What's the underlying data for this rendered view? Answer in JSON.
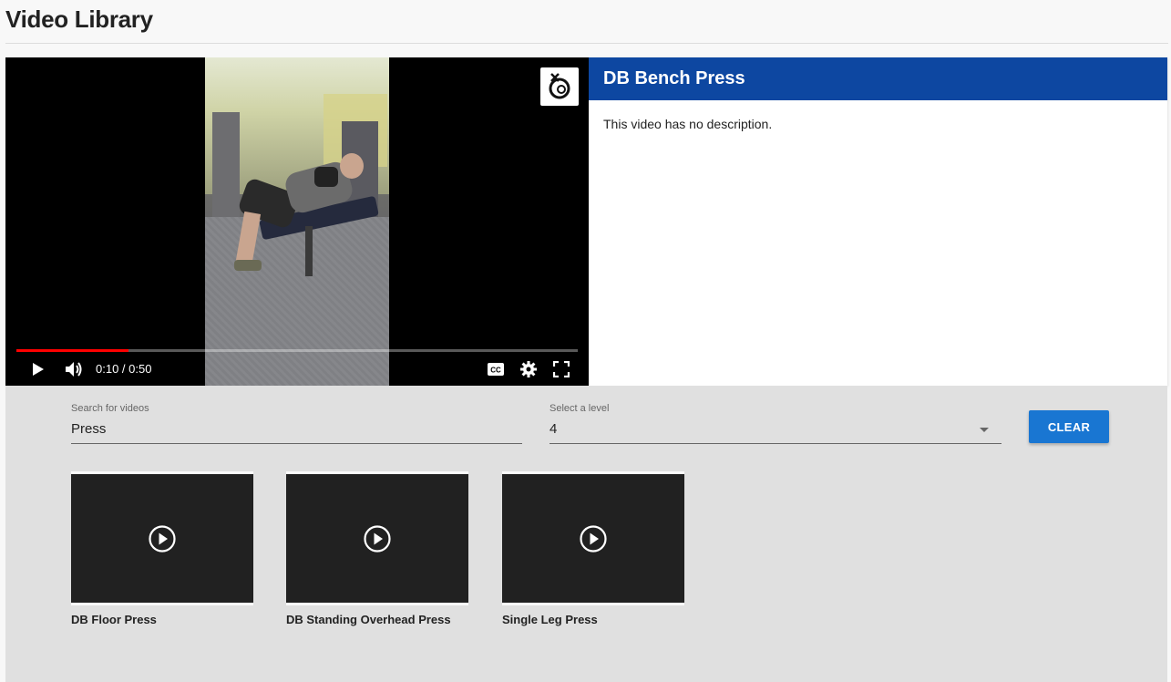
{
  "page": {
    "title": "Video Library"
  },
  "player": {
    "current_time": "0:10",
    "duration": "0:50",
    "time_separator": " / ",
    "progress_fraction": 0.2,
    "progress_color": "#ff0000",
    "icons": {
      "play": "play-icon",
      "volume": "volume-icon",
      "captions": "closed-captions-icon",
      "settings": "settings-gear-icon",
      "fullscreen": "fullscreen-icon",
      "logo": "channel-logo-icon"
    }
  },
  "detail": {
    "title": "DB Bench Press",
    "description": "This video has no description.",
    "header_color": "#0d47a1"
  },
  "search": {
    "label": "Search for videos",
    "value": "Press"
  },
  "level": {
    "label": "Select a level",
    "value": "4"
  },
  "clear_button": {
    "label": "CLEAR",
    "color": "#1976d2"
  },
  "videos": [
    {
      "title": "DB Floor Press"
    },
    {
      "title": "DB Standing Overhead Press"
    },
    {
      "title": "Single Leg Press"
    }
  ]
}
